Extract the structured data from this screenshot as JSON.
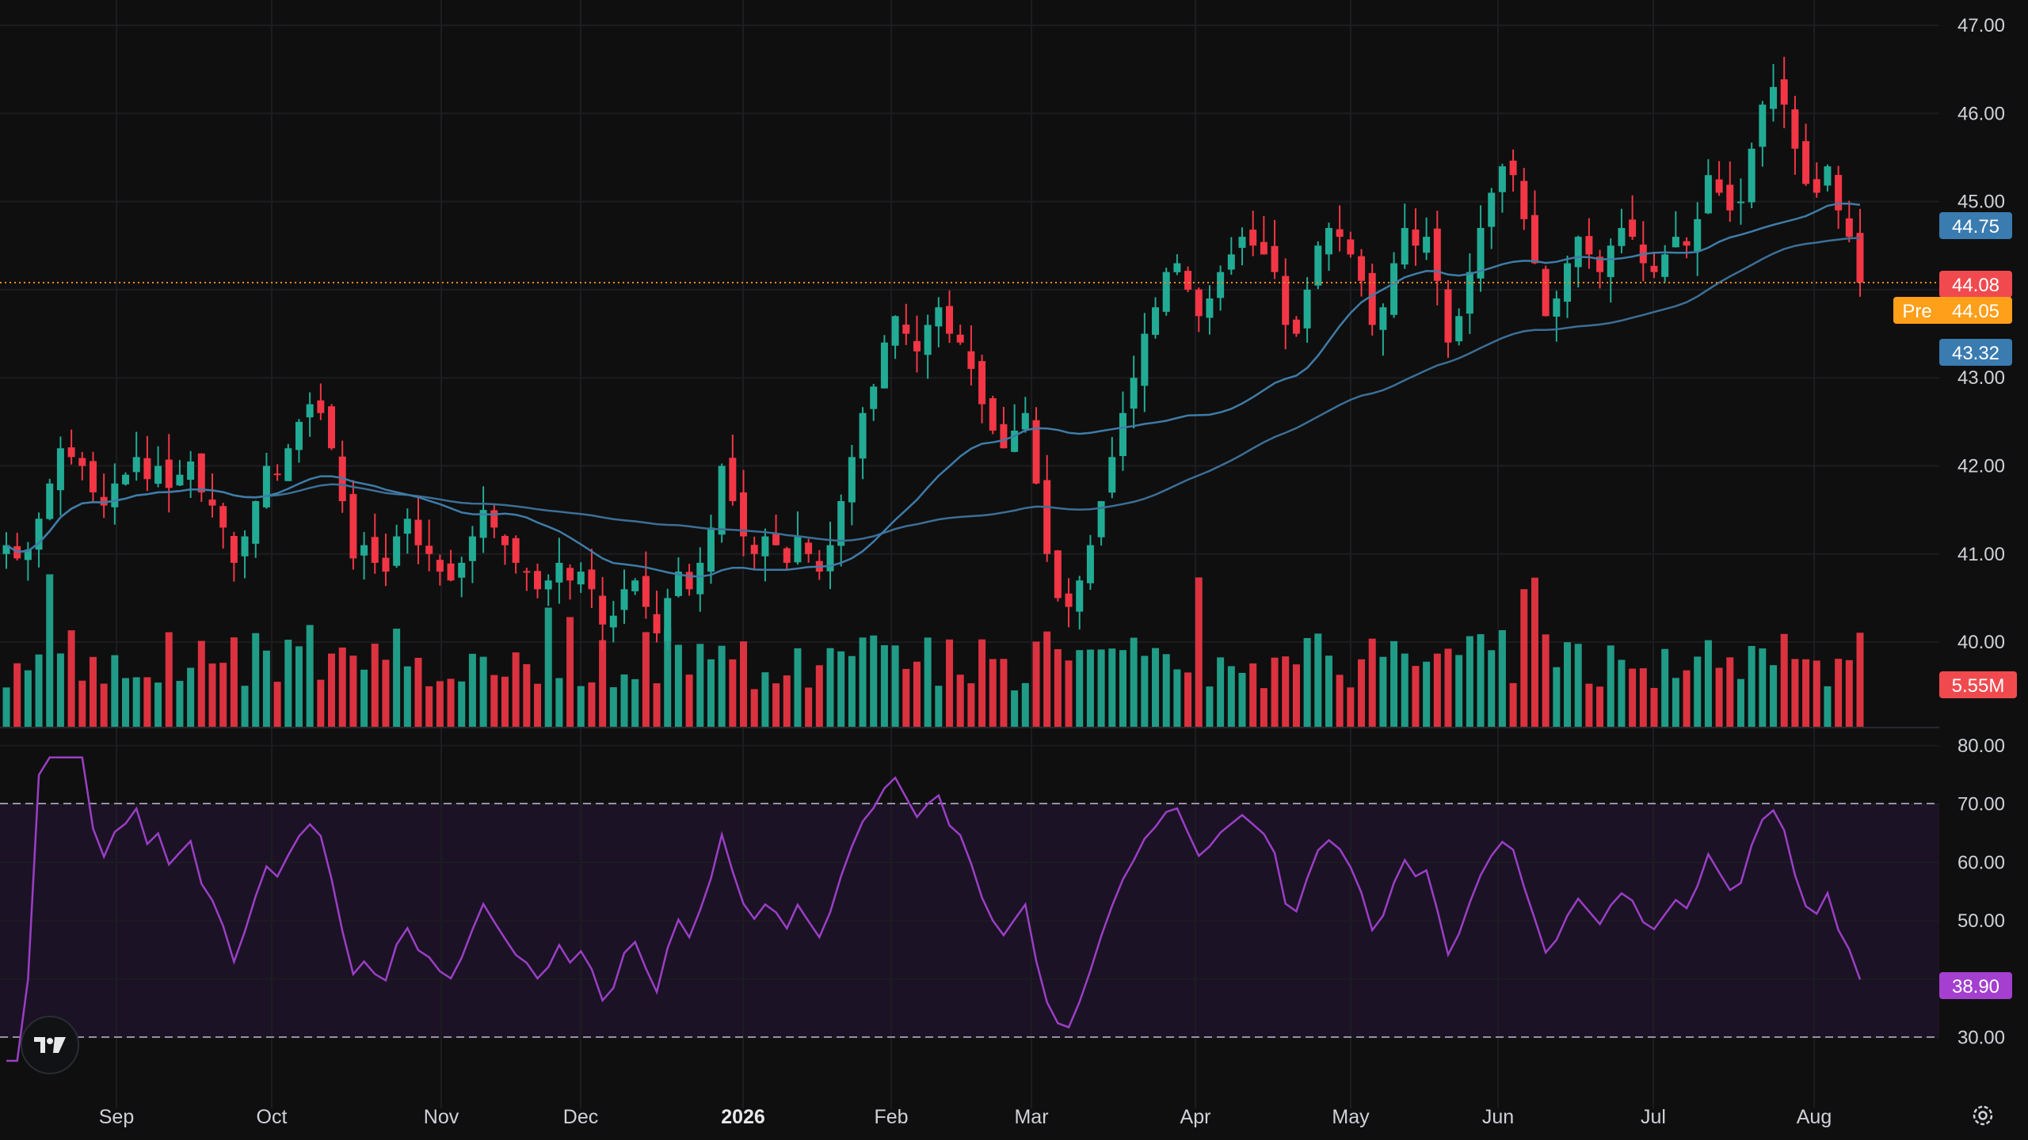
{
  "chart_data": {
    "type": "candlestick",
    "x_labels": [
      "Sep",
      "Oct",
      "Nov",
      "Dec",
      "2026",
      "Feb",
      "Mar",
      "Apr",
      "May",
      "Jun",
      "Jul",
      "Aug"
    ],
    "bold_x_label": "2026",
    "price_axis": {
      "ticks": [
        "47.00",
        "46.00",
        "45.00",
        "44.00",
        "43.00",
        "42.00",
        "41.00",
        "40.00"
      ],
      "ylim": [
        39.5,
        47.2
      ]
    },
    "volume_axis": {
      "last_volume_label": "5.55M"
    },
    "rsi_axis": {
      "ticks": [
        "80.00",
        "70.00",
        "60.00",
        "50.00",
        "40.00",
        "30.00"
      ],
      "ylim": [
        25,
        80
      ],
      "overbought": 70,
      "oversold": 30
    },
    "badges": {
      "ma_fast": "44.75",
      "last_price": "44.08",
      "premarket_label": "Pre",
      "premarket_price": "44.05",
      "ma_slow": "43.32",
      "volume": "5.55M",
      "rsi": "38.90"
    },
    "close_series": [
      41.1,
      40.95,
      41.05,
      41.4,
      41.8,
      42.2,
      42.1,
      42.0,
      41.7,
      41.55,
      41.8,
      41.9,
      42.1,
      41.85,
      42.0,
      41.75,
      41.9,
      42.05,
      41.7,
      41.55,
      41.3,
      40.9,
      41.2,
      41.6,
      42.0,
      41.9,
      42.2,
      42.5,
      42.7,
      42.6,
      42.2,
      41.6,
      40.95,
      41.1,
      40.9,
      40.8,
      41.2,
      41.4,
      41.1,
      41.0,
      40.8,
      40.7,
      40.9,
      41.2,
      41.5,
      41.3,
      41.1,
      40.9,
      40.8,
      40.6,
      40.7,
      40.9,
      40.7,
      40.8,
      40.6,
      40.2,
      40.3,
      40.6,
      40.7,
      40.4,
      40.1,
      40.5,
      40.8,
      40.6,
      40.9,
      41.3,
      42.0,
      41.6,
      41.2,
      41.0,
      41.2,
      41.1,
      40.9,
      41.2,
      41.0,
      40.8,
      41.1,
      41.6,
      42.1,
      42.6,
      42.9,
      43.4,
      43.7,
      43.5,
      43.3,
      43.6,
      43.8,
      43.5,
      43.4,
      43.1,
      42.7,
      42.4,
      42.2,
      42.4,
      42.6,
      41.8,
      41.0,
      40.5,
      40.4,
      40.7,
      41.1,
      41.6,
      42.1,
      42.6,
      43.0,
      43.5,
      43.8,
      44.2,
      44.3,
      44.0,
      43.7,
      43.9,
      44.2,
      44.4,
      44.6,
      44.5,
      44.4,
      44.2,
      43.6,
      43.5,
      44.0,
      44.5,
      44.7,
      44.6,
      44.4,
      44.1,
      43.6,
      43.8,
      44.3,
      44.7,
      44.5,
      44.6,
      44.1,
      43.4,
      43.7,
      44.2,
      44.7,
      45.1,
      45.4,
      45.3,
      44.8,
      44.3,
      43.7,
      43.9,
      44.3,
      44.6,
      44.4,
      44.2,
      44.5,
      44.7,
      44.6,
      44.3,
      44.2,
      44.4,
      44.6,
      44.5,
      44.8,
      45.3,
      45.1,
      44.9,
      45.0,
      45.6,
      46.1,
      46.3,
      46.1,
      45.6,
      45.2,
      45.1,
      45.4,
      44.9,
      44.6,
      44.08
    ]
  }
}
